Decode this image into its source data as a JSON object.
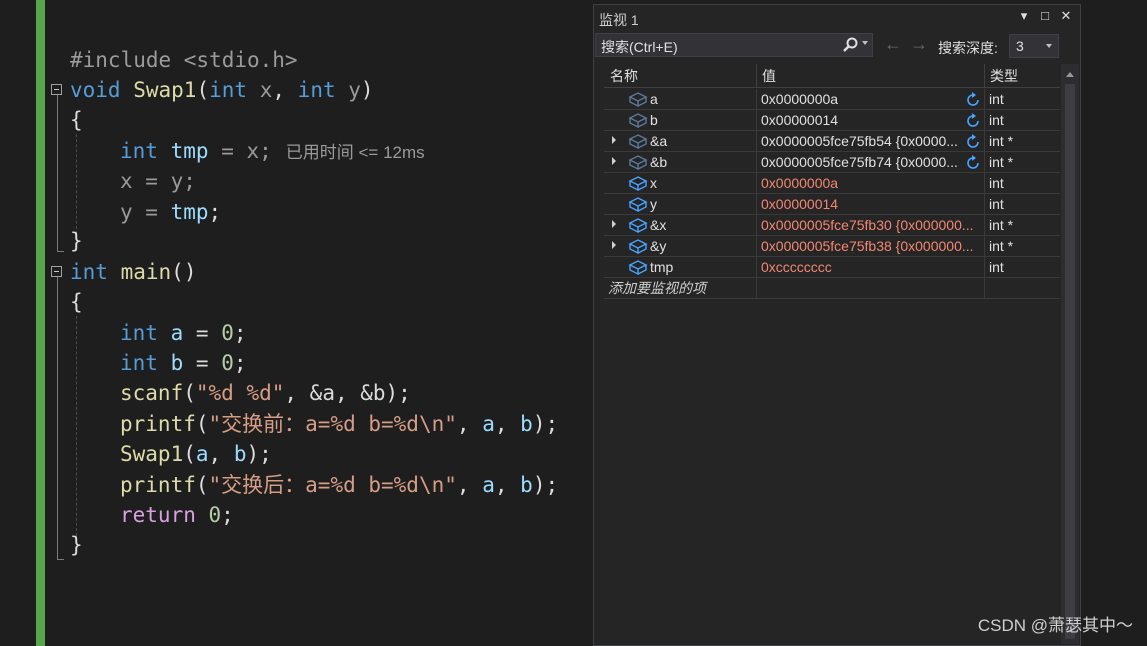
{
  "editor": {
    "lines": {
      "l1": {
        "pp": "#include <stdio.h>"
      },
      "l2": {
        "kw": "void",
        "fn": "Swap1",
        "open": "(",
        "kw2": "int",
        "p1": "x",
        "comma": ",",
        "kw3": "int",
        "p2": "y",
        "close": ")"
      },
      "l3": {
        "text": "{"
      },
      "l4": {
        "kw": "int",
        "var": "tmp",
        "rest": "= x;",
        "hint": "已用时间 <= 12ms"
      },
      "l5": {
        "text": "x = y;"
      },
      "l6": {
        "a": "y = ",
        "var": "tmp",
        "b": ";"
      },
      "l7": {
        "text": "}"
      },
      "l8": {
        "kw": "int",
        "fn": "main",
        "rest": "()"
      },
      "l9": {
        "text": "{"
      },
      "l10": {
        "kw": "int",
        "var": "a",
        "eq": "=",
        "num": "0",
        "semi": ";"
      },
      "l11": {
        "kw": "int",
        "var": "b",
        "eq": "=",
        "num": "0",
        "semi": ";"
      },
      "l12": {
        "fn": "scanf",
        "open": "(",
        "str": "\"%d %d\"",
        "rest": ", &a, &b);"
      },
      "l13": {
        "fn": "printf",
        "open": "(",
        "str": "\"交换前：a=%d b=%d\\n\"",
        "c1": ",",
        "a": "a",
        "c2": ",",
        "b": "b",
        "close": ");"
      },
      "l14": {
        "fn": "Swap1",
        "open": "(",
        "a": "a",
        "c": ",",
        "b": "b",
        "close": ");"
      },
      "l15": {
        "fn": "printf",
        "open": "(",
        "str": "\"交换后：a=%d b=%d\\n\"",
        "c1": ",",
        "a": "a",
        "c2": ",",
        "b": "b",
        "close": ");"
      },
      "l16": {
        "ctl": "return",
        "num": "0",
        "semi": ";"
      },
      "l17": {
        "text": "}"
      }
    }
  },
  "watch": {
    "title": "监视 1",
    "title_buttons": {
      "dropdown": "▾",
      "maximize": "□",
      "close": "✕"
    },
    "search_placeholder": "搜索(Ctrl+E)",
    "nav_back": "←",
    "nav_forward": "→",
    "depth_label": "搜索深度:",
    "depth_value": "3",
    "columns": {
      "name": "名称",
      "value": "值",
      "type": "类型"
    },
    "rows": [
      {
        "name": "a",
        "value": "0x0000000a",
        "type": "int"
      },
      {
        "name": "b",
        "value": "0x00000014",
        "type": "int"
      },
      {
        "name": "&a",
        "value": "0x0000005fce75fb54 {0x0000...",
        "type": "int *"
      },
      {
        "name": "&b",
        "value": "0x0000005fce75fb74 {0x0000...",
        "type": "int *"
      },
      {
        "name": "x",
        "value": "0x0000000a",
        "type": "int"
      },
      {
        "name": "y",
        "value": "0x00000014",
        "type": "int"
      },
      {
        "name": "&x",
        "value": "0x0000005fce75fb30 {0x000000...",
        "type": "int *"
      },
      {
        "name": "&y",
        "value": "0x0000005fce75fb38 {0x000000...",
        "type": "int *"
      },
      {
        "name": "tmp",
        "value": "0xcccccccc",
        "type": "int"
      }
    ],
    "add_item": "添加要监视的项"
  },
  "watermark": "CSDN @萧瑟其中～",
  "colors": {
    "accent_bar": "#57a64a",
    "changed_value": "#f48771",
    "keyword": "#569cd6",
    "function": "#dcdcaa"
  }
}
